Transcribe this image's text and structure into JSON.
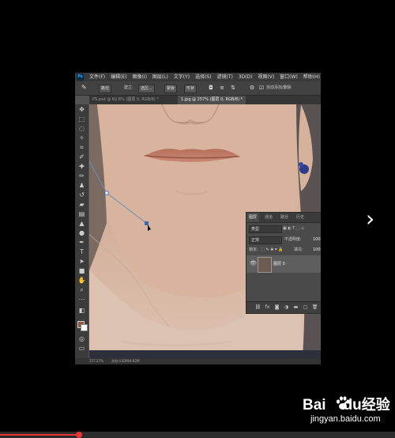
{
  "app": {
    "logo": "Ps",
    "menus": [
      "文件(F)",
      "编辑(E)",
      "图像(I)",
      "图层(L)",
      "文字(Y)",
      "选择(S)",
      "滤镜(T)",
      "3D(D)",
      "视图(V)",
      "窗口(W)",
      "帮助(H)"
    ]
  },
  "options": {
    "mode": "路径",
    "build_label": "建立:",
    "selection_btn": "选区...",
    "mask_btn": "蒙版",
    "shape_btn": "形状",
    "auto_add_delete": "自动添加/删除"
  },
  "tabs": [
    {
      "label": "PS.psd @ 82.6% (图层 0, RGB/8) *"
    },
    {
      "label": "1.jpg @ 257% (图层 0, RGB/8) *"
    }
  ],
  "status": {
    "zoom": "257.27%",
    "doc": "文档:4.82M/4.82M"
  },
  "layers_panel": {
    "tabs": [
      "图层",
      "通道",
      "路径",
      "历史"
    ],
    "kind_filter": "类型",
    "blend_mode": "正常",
    "opacity_label": "不透明度:",
    "opacity_value": "100",
    "lock_label": "锁定:",
    "fill_label": "填充:",
    "fill_value": "100",
    "layer_name": "图层 0"
  },
  "icons": {
    "next": "chevron-right-icon",
    "pen_tool": "pen-icon"
  },
  "watermark": {
    "brand_left": "Bai",
    "brand_right": "du",
    "brand_cn": "经验",
    "domain": "jingyan.baidu.com"
  },
  "colors": {
    "accent": "#31a8ff",
    "progress": "#ee3333",
    "fg_swatch": "#8a5a3c"
  },
  "video_progress": 0.2
}
